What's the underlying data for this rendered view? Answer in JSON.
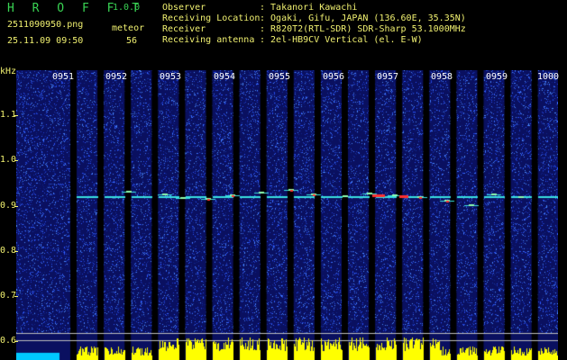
{
  "header": {
    "app_title": "H R O F F T",
    "version": "1.0.0",
    "filename": "2511090950.png",
    "datetime": "25.11.09 09:50",
    "meteor_label": "meteor",
    "meteor_count": "56"
  },
  "station_info": [
    {
      "key": "Observer",
      "value": ": Takanori Kawachi"
    },
    {
      "key": "Receiving Location",
      "value": ": Ogaki, Gifu, JAPAN (136.60E, 35.35N)"
    },
    {
      "key": "Receiver",
      "value": ": R820T2(RTL-SDR) SDR-Sharp 53.1000MHz"
    },
    {
      "key": "Receiving antenna",
      "value": ": 2el-HB9CV Vertical (el. E-W)"
    }
  ],
  "spectrogram": {
    "freq_unit": "kHz",
    "y_ticks": [
      "1.1",
      "1.0",
      "0.9",
      "0.8",
      "0.7",
      "0.6"
    ],
    "time_labels": [
      "0951",
      "0952",
      "0953",
      "0954",
      "0955",
      "0956",
      "0957",
      "0958",
      "0959",
      "1000"
    ],
    "colors": {
      "background": "#0a1060",
      "noise": "#1f3fd0",
      "gap": "#000000",
      "carrier": "#39e0e0",
      "hot": "#ff3030",
      "activity": "#ffff00",
      "baseline": "#00c8ff"
    }
  }
}
